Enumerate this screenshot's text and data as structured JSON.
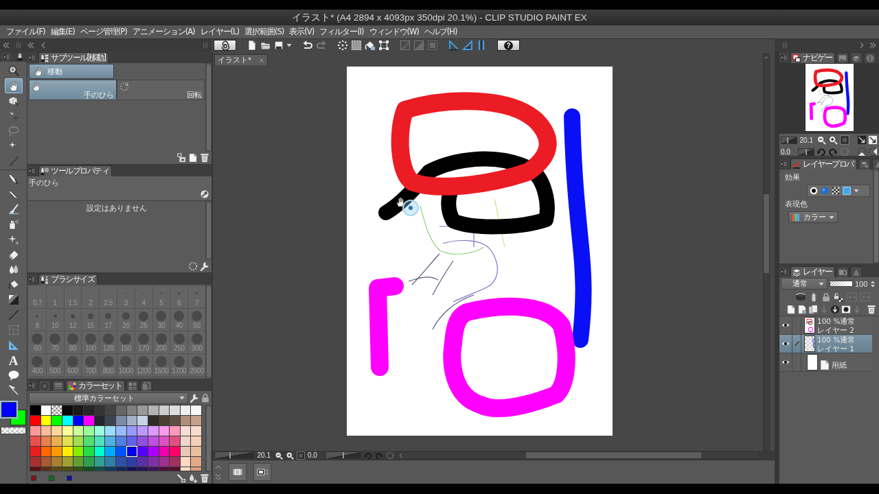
{
  "window": {
    "title": "イラスト* (A4 2894 x 4093px 350dpi 20.1%) - CLIP STUDIO PAINT EX"
  },
  "menu": [
    "ファイル(F)",
    "編集(E)",
    "ページ管理(P)",
    "アニメーション(A)",
    "レイヤー(L)",
    "選択範囲(S)",
    "表示(V)",
    "フィルター(I)",
    "ウィンドウ(W)",
    "ヘルプ(H)"
  ],
  "command_bar": {
    "snap_toggles": [
      {
        "on": true
      },
      {
        "on": true
      },
      {
        "on": true
      }
    ],
    "help_label": "?"
  },
  "tool_groups": [
    [
      {
        "kind": "zoom",
        "selected": false
      },
      {
        "kind": "hand",
        "selected": true
      },
      {
        "kind": "move-layer",
        "selected": false
      },
      {
        "kind": "operation",
        "selected": false
      },
      {
        "kind": "lasso",
        "selected": false
      },
      {
        "kind": "wand",
        "selected": false
      },
      {
        "kind": "dropper",
        "selected": false
      }
    ],
    [
      {
        "kind": "pen",
        "selected": false
      },
      {
        "kind": "pencil",
        "selected": false
      },
      {
        "kind": "brush",
        "selected": false
      },
      {
        "kind": "airbrush",
        "selected": false
      },
      {
        "kind": "sparkle",
        "selected": false
      },
      {
        "kind": "eraser",
        "selected": false
      },
      {
        "kind": "blend",
        "selected": false
      },
      {
        "kind": "bucket",
        "selected": false
      },
      {
        "kind": "gradient",
        "selected": false
      },
      {
        "kind": "line",
        "selected": false
      },
      {
        "kind": "frame",
        "selected": false
      },
      {
        "kind": "ruler",
        "selected": false
      },
      {
        "kind": "text",
        "glyph": "A",
        "selected": false
      },
      {
        "kind": "balloon",
        "selected": false
      },
      {
        "kind": "pointer",
        "selected": false
      }
    ]
  ],
  "colors": {
    "main": {
      "color": "#0000ff",
      "selected": true
    },
    "sub": {
      "color": "#00ff00",
      "selected": false
    }
  },
  "sub_tool": {
    "tab": "サブツール[移動]",
    "group": {
      "label": "移動",
      "selected": true
    },
    "items": [
      {
        "kind": "hand",
        "label": "手のひら",
        "selected": true
      },
      {
        "kind": "rotate",
        "label": "回転",
        "selected": false
      }
    ]
  },
  "tool_property": {
    "tab": "ツールプロパティ",
    "tool_name": "手のひら",
    "message": "設定はありません"
  },
  "brush_size": {
    "tab": "ブラシサイズ",
    "sizes": [
      "0.7",
      "1",
      "1.5",
      "2",
      "2.5",
      "3",
      "4",
      "5",
      "6",
      "7",
      "8",
      "10",
      "12",
      "15",
      "17",
      "20",
      "25",
      "30",
      "40",
      "50",
      "60",
      "70",
      "80",
      "100",
      "120",
      "150",
      "170",
      "200",
      "250",
      "300",
      "400",
      "500",
      "600",
      "700",
      "800",
      "1000",
      "1200",
      "1500",
      "1700",
      "2000"
    ]
  },
  "color_set": {
    "tabs": [
      {
        "kind": "wheel",
        "selected": false
      },
      {
        "kind": "sliders",
        "selected": false
      },
      {
        "kind": "set",
        "label": "カラーセット",
        "selected": true
      },
      {
        "kind": "intermediate",
        "selected": false
      },
      {
        "kind": "similar",
        "selected": false
      }
    ],
    "set_name": "標準カラーセット",
    "swatches": [
      [
        {
          "kind": "solid",
          "color": "#000000",
          "selected": false
        },
        {
          "kind": "solid",
          "color": "#ffffff",
          "selected": false
        },
        {
          "kind": "transparent",
          "selected": false
        },
        {
          "kind": "solid",
          "color": "#0a0a0a",
          "selected": false
        },
        {
          "kind": "solid",
          "color": "#1a1a1a",
          "selected": false
        },
        {
          "kind": "solid",
          "color": "#262626",
          "selected": false
        },
        {
          "kind": "solid",
          "color": "#333333",
          "selected": false
        },
        {
          "kind": "solid",
          "color": "#444444",
          "selected": false
        },
        {
          "kind": "solid",
          "color": "#666666",
          "selected": false
        },
        {
          "kind": "solid",
          "color": "#808080",
          "selected": false
        },
        {
          "kind": "solid",
          "color": "#999999",
          "selected": false
        },
        {
          "kind": "solid",
          "color": "#b3b3b3",
          "selected": false
        },
        {
          "kind": "solid",
          "color": "#cccccc",
          "selected": false
        },
        {
          "kind": "solid",
          "color": "#dddddd",
          "selected": false
        },
        {
          "kind": "solid",
          "color": "#eeeeee",
          "selected": false
        },
        {
          "kind": "solid",
          "color": "#f7f7f7",
          "selected": false
        }
      ],
      [
        {
          "kind": "solid",
          "color": "#ff0000",
          "selected": false
        },
        {
          "kind": "solid",
          "color": "#ffff00",
          "selected": false
        },
        {
          "kind": "solid",
          "color": "#00ff00",
          "selected": false
        },
        {
          "kind": "solid",
          "color": "#00ffff",
          "selected": false
        },
        {
          "kind": "solid",
          "color": "#0000ff",
          "selected": false
        },
        {
          "kind": "solid",
          "color": "#ff00ff",
          "selected": false
        },
        {
          "kind": "solid",
          "color": "#23262b",
          "selected": false
        },
        {
          "kind": "solid",
          "color": "#3d4450",
          "selected": false
        },
        {
          "kind": "solid",
          "color": "#7a8ca5",
          "selected": false
        },
        {
          "kind": "solid",
          "color": "#a3b0c8",
          "selected": false
        },
        {
          "kind": "solid",
          "color": "#c8d2e6",
          "selected": false
        },
        {
          "kind": "solid",
          "color": "#2e2e26",
          "selected": false
        },
        {
          "kind": "solid",
          "color": "#4a3f33",
          "selected": false
        },
        {
          "kind": "solid",
          "color": "#5e5040",
          "selected": false
        },
        {
          "kind": "solid",
          "color": "#b08e7a",
          "selected": false
        },
        {
          "kind": "solid",
          "color": "#c4a08c",
          "selected": false
        }
      ],
      [
        {
          "kind": "solid",
          "color": "#ff9999",
          "selected": false
        },
        {
          "kind": "solid",
          "color": "#ffbb99",
          "selected": false
        },
        {
          "kind": "solid",
          "color": "#ffd699",
          "selected": false
        },
        {
          "kind": "solid",
          "color": "#ffff99",
          "selected": false
        },
        {
          "kind": "solid",
          "color": "#ccff99",
          "selected": false
        },
        {
          "kind": "solid",
          "color": "#99ff99",
          "selected": false
        },
        {
          "kind": "solid",
          "color": "#99ffdd",
          "selected": false
        },
        {
          "kind": "solid",
          "color": "#99ddff",
          "selected": false
        },
        {
          "kind": "solid",
          "color": "#99bbff",
          "selected": false
        },
        {
          "kind": "solid",
          "color": "#9999ff",
          "selected": false
        },
        {
          "kind": "solid",
          "color": "#bb99ff",
          "selected": false
        },
        {
          "kind": "solid",
          "color": "#dd99ff",
          "selected": false
        },
        {
          "kind": "solid",
          "color": "#ff99ee",
          "selected": false
        },
        {
          "kind": "solid",
          "color": "#ff99bb",
          "selected": false
        },
        {
          "kind": "solid",
          "color": "#f5ddd5",
          "selected": false
        },
        {
          "kind": "solid",
          "color": "#f8dccb",
          "selected": false
        }
      ],
      [
        {
          "kind": "solid",
          "color": "#e85050",
          "selected": false
        },
        {
          "kind": "solid",
          "color": "#e88050",
          "selected": false
        },
        {
          "kind": "solid",
          "color": "#e8b050",
          "selected": false
        },
        {
          "kind": "solid",
          "color": "#e0e050",
          "selected": false
        },
        {
          "kind": "solid",
          "color": "#a0e050",
          "selected": false
        },
        {
          "kind": "solid",
          "color": "#50e070",
          "selected": false
        },
        {
          "kind": "solid",
          "color": "#50e0c0",
          "selected": false
        },
        {
          "kind": "solid",
          "color": "#50b0e0",
          "selected": false
        },
        {
          "kind": "solid",
          "color": "#5080e0",
          "selected": false
        },
        {
          "kind": "solid",
          "color": "#6060e8",
          "selected": false
        },
        {
          "kind": "solid",
          "color": "#9050e0",
          "selected": false
        },
        {
          "kind": "solid",
          "color": "#c050e0",
          "selected": false
        },
        {
          "kind": "solid",
          "color": "#e050c0",
          "selected": false
        },
        {
          "kind": "solid",
          "color": "#e05080",
          "selected": false
        },
        {
          "kind": "solid",
          "color": "#f0d6cc",
          "selected": false
        },
        {
          "kind": "solid",
          "color": "#f5d0b8",
          "selected": false
        }
      ],
      [
        {
          "kind": "solid",
          "color": "#e81e1e",
          "selected": false
        },
        {
          "kind": "solid",
          "color": "#ff6600",
          "selected": false
        },
        {
          "kind": "solid",
          "color": "#ff9900",
          "selected": false
        },
        {
          "kind": "solid",
          "color": "#ffee00",
          "selected": false
        },
        {
          "kind": "solid",
          "color": "#88ee00",
          "selected": false
        },
        {
          "kind": "solid",
          "color": "#22dd44",
          "selected": false
        },
        {
          "kind": "solid",
          "color": "#00ffcc",
          "selected": false
        },
        {
          "kind": "solid",
          "color": "#00aaff",
          "selected": false
        },
        {
          "kind": "solid",
          "color": "#0055ff",
          "selected": false
        },
        {
          "kind": "solid",
          "color": "#0000ff",
          "selected": true
        },
        {
          "kind": "solid",
          "color": "#5500ff",
          "selected": false
        },
        {
          "kind": "solid",
          "color": "#aa00ff",
          "selected": false
        },
        {
          "kind": "solid",
          "color": "#ee00aa",
          "selected": false
        },
        {
          "kind": "solid",
          "color": "#ff0066",
          "selected": false
        },
        {
          "kind": "solid",
          "color": "#e8c8b8",
          "selected": false
        },
        {
          "kind": "solid",
          "color": "#e8bfa0",
          "selected": false
        }
      ],
      [
        {
          "kind": "solid",
          "color": "#a83030",
          "selected": false
        },
        {
          "kind": "solid",
          "color": "#a85a30",
          "selected": false
        },
        {
          "kind": "solid",
          "color": "#a88030",
          "selected": false
        },
        {
          "kind": "solid",
          "color": "#a0a030",
          "selected": false
        },
        {
          "kind": "solid",
          "color": "#60a030",
          "selected": false
        },
        {
          "kind": "solid",
          "color": "#30a050",
          "selected": false
        },
        {
          "kind": "solid",
          "color": "#30a090",
          "selected": false
        },
        {
          "kind": "solid",
          "color": "#3080a8",
          "selected": false
        },
        {
          "kind": "solid",
          "color": "#3050a8",
          "selected": false
        },
        {
          "kind": "solid",
          "color": "#303ca8",
          "selected": false
        },
        {
          "kind": "solid",
          "color": "#5a30a8",
          "selected": false
        },
        {
          "kind": "solid",
          "color": "#8030a8",
          "selected": false
        },
        {
          "kind": "solid",
          "color": "#a03090",
          "selected": false
        },
        {
          "kind": "solid",
          "color": "#a03060",
          "selected": false
        },
        {
          "kind": "solid",
          "color": "#fcd9c0",
          "selected": false
        },
        {
          "kind": "solid",
          "color": "#e0aa88",
          "selected": false
        }
      ],
      [
        {
          "kind": "solid",
          "color": "#5a1010",
          "selected": false
        },
        {
          "kind": "solid",
          "color": "#5a3010",
          "selected": false
        },
        {
          "kind": "solid",
          "color": "#5a4a10",
          "selected": false
        },
        {
          "kind": "solid",
          "color": "#505010",
          "selected": false
        },
        {
          "kind": "solid",
          "color": "#305010",
          "selected": false
        },
        {
          "kind": "solid",
          "color": "#105020",
          "selected": false
        },
        {
          "kind": "solid",
          "color": "#105048",
          "selected": false
        },
        {
          "kind": "solid",
          "color": "#103a5a",
          "selected": false
        },
        {
          "kind": "solid",
          "color": "#10285a",
          "selected": false
        },
        {
          "kind": "solid",
          "color": "#10105a",
          "selected": false
        },
        {
          "kind": "solid",
          "color": "#28105a",
          "selected": false
        },
        {
          "kind": "solid",
          "color": "#40105a",
          "selected": false
        },
        {
          "kind": "solid",
          "color": "#501040",
          "selected": false
        },
        {
          "kind": "solid",
          "color": "#501028",
          "selected": false
        },
        {
          "kind": "solid",
          "color": "#fde0c8",
          "selected": false
        },
        {
          "kind": "solid",
          "color": "#d8a080",
          "selected": false
        }
      ]
    ],
    "recent": [
      {
        "color": "#8b1010"
      },
      {
        "color": "#107020"
      },
      {
        "color": "#1010a0"
      }
    ]
  },
  "document": {
    "tab": "イラスト*"
  },
  "canvas_bar": {
    "zoom": {
      "reading": "20.1",
      "level": 0.4
    },
    "rotation": {
      "reading": "0.0",
      "level": 0.5
    }
  },
  "navigator": {
    "tabs": [
      {
        "kind": "navigator",
        "label": "ナビゲー",
        "selected": true
      },
      {
        "kind": "sub-view",
        "selected": false
      },
      {
        "kind": "box",
        "selected": false
      },
      {
        "kind": "info",
        "selected": false
      }
    ],
    "zoom": {
      "reading": "20.1",
      "level": 0.4
    },
    "rotation": {
      "reading": "0.0",
      "level": 0.5
    }
  },
  "layer_property": {
    "tabs": [
      {
        "kind": "property",
        "label": "レイヤープロパ",
        "selected": true
      },
      {
        "kind": "search",
        "selected": false
      },
      {
        "kind": "cone",
        "selected": false
      }
    ],
    "effect_label": "効果",
    "color_label": "表現色",
    "color_mode": "カラー"
  },
  "layers": {
    "tabs": [
      {
        "kind": "layer",
        "label": "レイヤー",
        "selected": true
      },
      {
        "kind": "animation",
        "selected": false
      },
      {
        "kind": "cone",
        "selected": false
      }
    ],
    "blend_mode": "通常",
    "opacity_slider": {
      "level": 1
    },
    "opacity": "100",
    "items": [
      {
        "kind": "raster",
        "opacity_blend": "100 %通常",
        "name": "レイヤー 2",
        "visible": true,
        "editing": false,
        "selected": false
      },
      {
        "kind": "raster",
        "opacity_blend": "100 %通常",
        "name": "レイヤー 1",
        "visible": true,
        "editing": true,
        "selected": true
      },
      {
        "kind": "paper",
        "name": "用紙",
        "visible": true,
        "editing": false,
        "selected": false
      }
    ]
  }
}
